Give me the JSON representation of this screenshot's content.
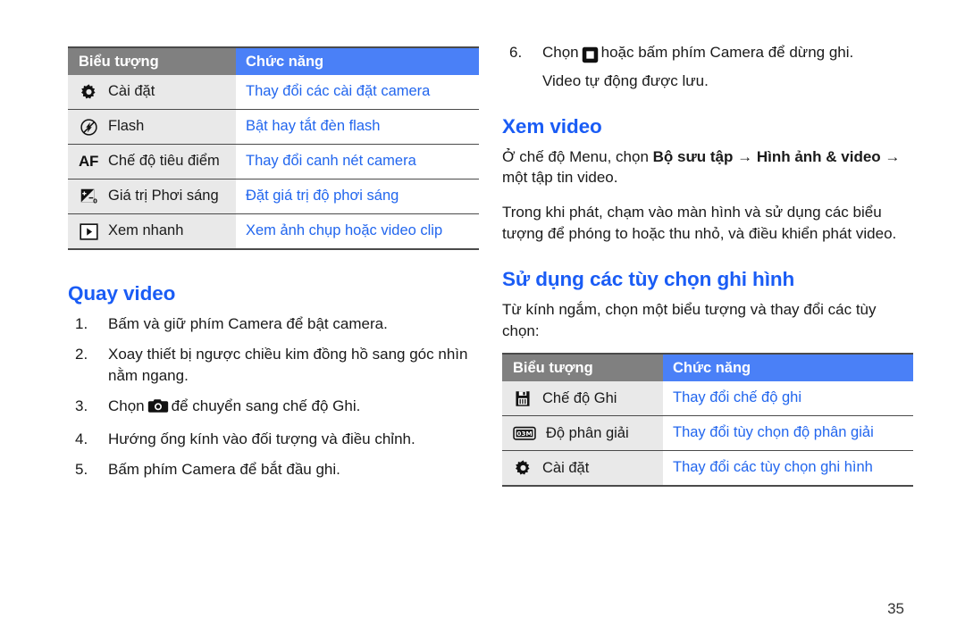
{
  "page": {
    "number": "35",
    "accent_blue": "#1a5cf5",
    "link_blue": "#2266ee",
    "header_gray": "#808080",
    "header_blue": "#4a80f7",
    "cell_gray": "#e9e9e9"
  },
  "left_table": {
    "headers": {
      "icon": "Biểu tượng",
      "function": "Chức năng"
    },
    "rows": [
      {
        "icon": "gear-icon",
        "label": "Cài đặt",
        "function": "Thay đổi các cài đặt camera"
      },
      {
        "icon": "flash-icon",
        "label": "Flash",
        "function": "Bật hay tắt đèn flash"
      },
      {
        "icon": "af-icon",
        "icon_text": "AF",
        "label": "Chế độ tiêu điểm",
        "function": "Thay đổi canh nét camera"
      },
      {
        "icon": "exposure-icon",
        "label": "Giá trị Phơi sáng",
        "function": "Đặt giá trị độ phơi sáng"
      },
      {
        "icon": "quickview-play-icon",
        "label": "Xem nhanh",
        "function": "Xem ảnh chụp hoặc video clip"
      }
    ]
  },
  "quay_video": {
    "heading": "Quay video",
    "steps": [
      {
        "num": "1.",
        "text_before": "Bấm và giữ phím Camera để bật camera.",
        "icon": null,
        "text_after": ""
      },
      {
        "num": "2.",
        "text_before": "Xoay thiết bị ngược chiều kim đồng hồ sang góc nhìn nằm ngang.",
        "icon": null,
        "text_after": ""
      },
      {
        "num": "3.",
        "text_before": "Chọn",
        "icon": "camera-icon",
        "text_after": "để chuyển sang chế độ Ghi."
      },
      {
        "num": "4.",
        "text_before": "Hướng ống kính vào đối tượng và điều chỉnh.",
        "icon": null,
        "text_after": ""
      },
      {
        "num": "5.",
        "text_before": "Bấm phím Camera để bắt đầu ghi.",
        "icon": null,
        "text_after": ""
      }
    ]
  },
  "step_six": {
    "num": "6.",
    "text_before": "Chọn",
    "icon": "stop-icon",
    "text_after": "hoặc bấm phím Camera để dừng ghi.",
    "substep": "Video tự động được lưu."
  },
  "xem_video": {
    "heading": "Xem video",
    "paragraph1_part1": "Ở chế độ Menu, chọn ",
    "paragraph1_bold1": "Bộ sưu tập",
    "paragraph1_part2": " → ",
    "paragraph1_bold2": "Hình ảnh & video",
    "paragraph1_part3": " → một tập tin video.",
    "paragraph2": "Trong khi phát, chạm vào màn hình và sử dụng các biểu tượng để phóng to hoặc thu nhỏ, và điều khiển phát video."
  },
  "su_dung": {
    "heading": "Sử dụng các tùy chọn ghi hình",
    "intro": "Từ kính ngắm, chọn một biểu tượng và thay đổi các tùy chọn:"
  },
  "right_table": {
    "headers": {
      "icon": "Biểu tượng",
      "function": "Chức năng"
    },
    "rows": [
      {
        "icon": "record-mode-icon",
        "label": "Chế độ Ghi",
        "function": "Thay đổi chế độ ghi"
      },
      {
        "icon": "resolution-icon",
        "icon_text": "03M",
        "label": "Độ phân giải",
        "function": "Thay đổi tùy chọn độ phân giải"
      },
      {
        "icon": "gear-icon",
        "label": "Cài đặt",
        "function": "Thay đổi các tùy chọn ghi hình"
      }
    ]
  }
}
